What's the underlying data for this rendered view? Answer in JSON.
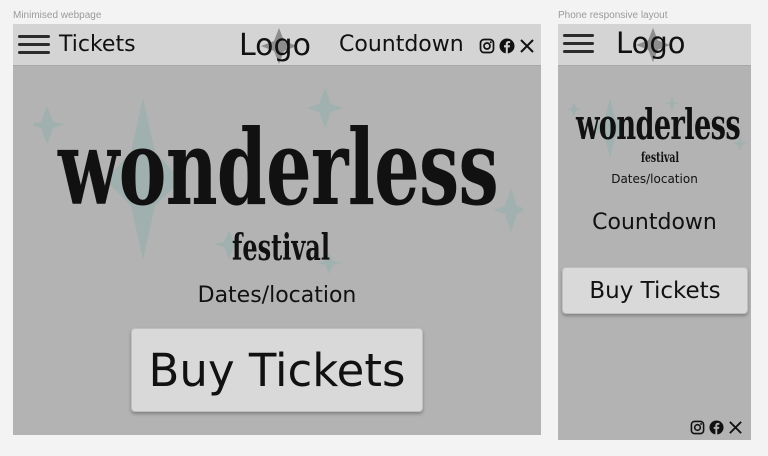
{
  "desktop": {
    "frame_label": "Minimised webpage",
    "nav": {
      "tickets_label": "Tickets",
      "logo_text": "Logo",
      "countdown_label": "Countdown"
    },
    "social_icons": [
      "instagram-icon",
      "facebook-icon",
      "x-icon"
    ],
    "hero": {
      "wordmark": "wonderless",
      "wordmark_sub": "festival",
      "dates_location": "Dates/location"
    },
    "buy_button_label": "Buy Tickets"
  },
  "mobile": {
    "frame_label": "Phone responsive layout",
    "nav": {
      "logo_text": "Logo"
    },
    "hero": {
      "wordmark": "wonderless",
      "wordmark_sub": "festival",
      "dates_location": "Dates/location"
    },
    "countdown_label": "Countdown",
    "buy_button_label": "Buy Tickets",
    "social_icons": [
      "instagram-icon",
      "facebook-icon",
      "x-icon"
    ]
  },
  "colors": {
    "page_bg": "#f3f3f3",
    "frame_bg": "#b3b3b3",
    "header_bg": "#d4d4d4",
    "button_bg": "#d9d9d9",
    "sparkle": "#9fb0ae",
    "text": "#111111"
  }
}
